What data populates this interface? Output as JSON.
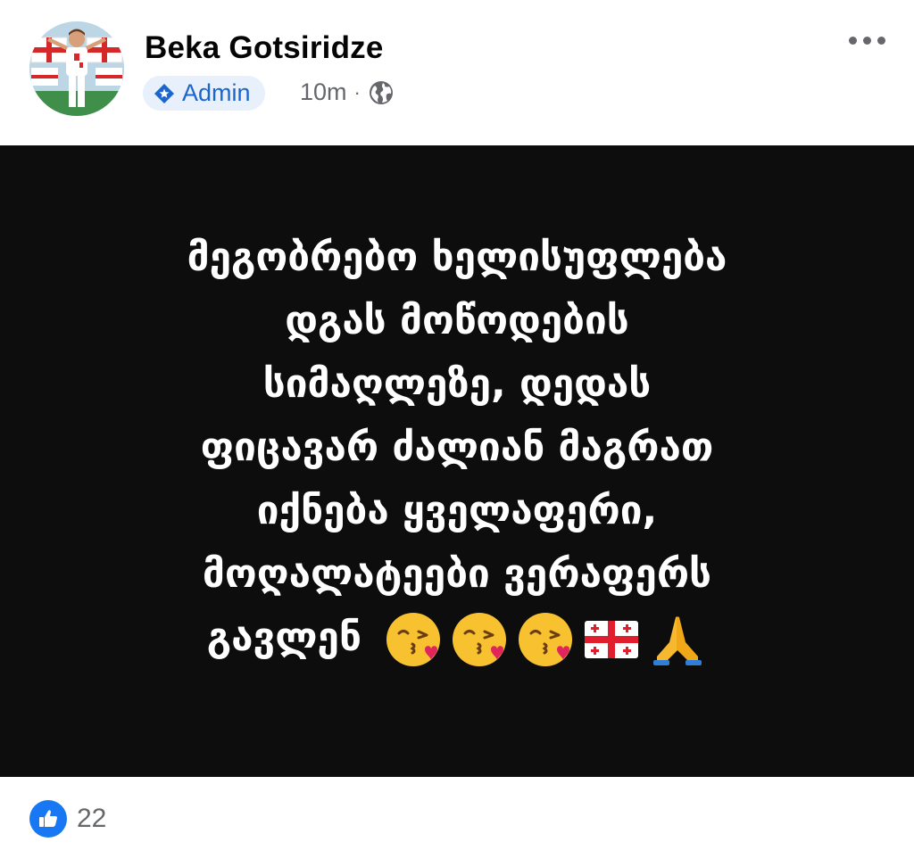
{
  "post": {
    "author": "Beka Gotsiridze",
    "role_badge": "Admin",
    "time": "10m",
    "separator": "·",
    "privacy_icon": "globe-icon",
    "more_icon": "more-horizontal-icon",
    "text_lines": [
      "მეგობრებო ხელისუფლება",
      "დგას მოწოდების",
      "სიმაღლეზე, დედას",
      "ფიცავარ ძალიან მაგრათ",
      "იქნება ყველაფერი,",
      "მოღალატეები ვერაფერს",
      "გავლენ"
    ],
    "emojis": [
      "kissing-heart-emoji",
      "kissing-heart-emoji",
      "kissing-heart-emoji",
      "georgia-flag-emoji",
      "folded-hands-emoji"
    ],
    "background_color": "#0d0d0d",
    "text_color": "#ffffff"
  },
  "reactions": {
    "icon": "like-icon",
    "count": "22",
    "color": "#1877f2"
  }
}
